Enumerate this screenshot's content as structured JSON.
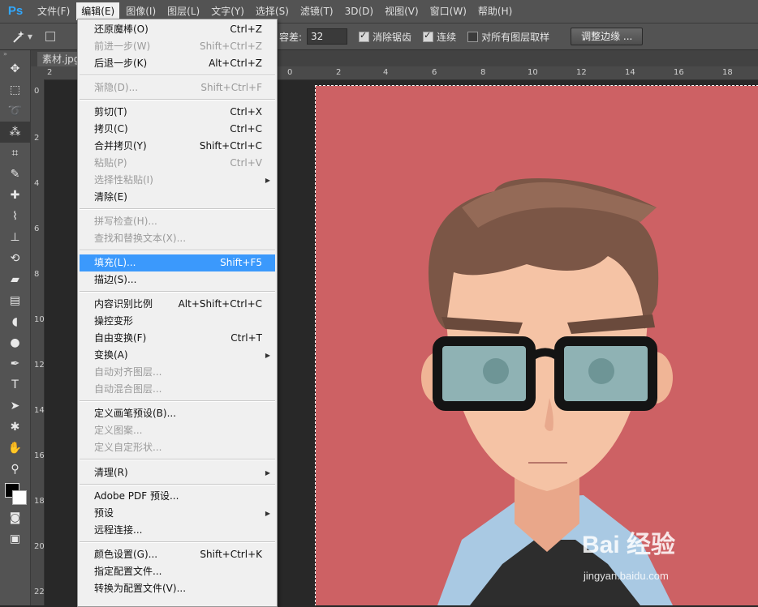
{
  "app": {
    "logo": "Ps"
  },
  "menubar": {
    "items": [
      {
        "label": "文件(F)"
      },
      {
        "label": "编辑(E)"
      },
      {
        "label": "图像(I)"
      },
      {
        "label": "图层(L)"
      },
      {
        "label": "文字(Y)"
      },
      {
        "label": "选择(S)"
      },
      {
        "label": "滤镜(T)"
      },
      {
        "label": "3D(D)"
      },
      {
        "label": "视图(V)"
      },
      {
        "label": "窗口(W)"
      },
      {
        "label": "帮助(H)"
      }
    ]
  },
  "options": {
    "tolerance_label": "容差:",
    "tolerance_value": "32",
    "antialias_label": "消除锯齿",
    "antialias_checked": true,
    "contiguous_label": "连续",
    "contiguous_checked": true,
    "sample_all_label": "对所有图层取样",
    "sample_all_checked": false,
    "refine_edge_label": "调整边缘 ..."
  },
  "document": {
    "tab_label": "素材.jpg",
    "ruler_top": [
      "2",
      "0",
      "2",
      "4",
      "6",
      "8",
      "10",
      "12",
      "14",
      "16",
      "18"
    ],
    "ruler_left": [
      "0",
      "2",
      "4",
      "6",
      "8",
      "10",
      "12",
      "14",
      "16",
      "18",
      "20",
      "22"
    ]
  },
  "edit_menu": {
    "items": [
      {
        "label": "还原魔棒(O)",
        "shortcut": "Ctrl+Z",
        "disabled": false
      },
      {
        "label": "前进一步(W)",
        "shortcut": "Shift+Ctrl+Z",
        "disabled": true
      },
      {
        "label": "后退一步(K)",
        "shortcut": "Alt+Ctrl+Z",
        "disabled": false
      },
      {
        "label": "渐隐(D)...",
        "shortcut": "Shift+Ctrl+F",
        "disabled": true
      },
      {
        "label": "剪切(T)",
        "shortcut": "Ctrl+X",
        "disabled": false
      },
      {
        "label": "拷贝(C)",
        "shortcut": "Ctrl+C",
        "disabled": false
      },
      {
        "label": "合并拷贝(Y)",
        "shortcut": "Shift+Ctrl+C",
        "disabled": false
      },
      {
        "label": "粘贴(P)",
        "shortcut": "Ctrl+V",
        "disabled": true
      },
      {
        "label": "选择性粘贴(I)",
        "shortcut": "",
        "disabled": true,
        "submenu": true
      },
      {
        "label": "清除(E)",
        "shortcut": "",
        "disabled": false
      },
      {
        "label": "拼写检查(H)...",
        "shortcut": "",
        "disabled": true
      },
      {
        "label": "查找和替换文本(X)...",
        "shortcut": "",
        "disabled": true
      },
      {
        "label": "填充(L)...",
        "shortcut": "Shift+F5",
        "disabled": false,
        "highlighted": true
      },
      {
        "label": "描边(S)...",
        "shortcut": "",
        "disabled": false
      },
      {
        "label": "内容识别比例",
        "shortcut": "Alt+Shift+Ctrl+C",
        "disabled": false
      },
      {
        "label": "操控变形",
        "shortcut": "",
        "disabled": false
      },
      {
        "label": "自由变换(F)",
        "shortcut": "Ctrl+T",
        "disabled": false
      },
      {
        "label": "变换(A)",
        "shortcut": "",
        "disabled": false,
        "submenu": true
      },
      {
        "label": "自动对齐图层...",
        "shortcut": "",
        "disabled": true
      },
      {
        "label": "自动混合图层...",
        "shortcut": "",
        "disabled": true
      },
      {
        "label": "定义画笔预设(B)...",
        "shortcut": "",
        "disabled": false
      },
      {
        "label": "定义图案...",
        "shortcut": "",
        "disabled": true
      },
      {
        "label": "定义自定形状...",
        "shortcut": "",
        "disabled": true
      },
      {
        "label": "清理(R)",
        "shortcut": "",
        "disabled": false,
        "submenu": true
      },
      {
        "label": "Adobe PDF 预设...",
        "shortcut": "",
        "disabled": false
      },
      {
        "label": "预设",
        "shortcut": "",
        "disabled": false,
        "submenu": true
      },
      {
        "label": "远程连接...",
        "shortcut": "",
        "disabled": false
      },
      {
        "label": "颜色设置(G)...",
        "shortcut": "Shift+Ctrl+K",
        "disabled": false
      },
      {
        "label": "指定配置文件...",
        "shortcut": "",
        "disabled": false
      },
      {
        "label": "转换为配置文件(V)...",
        "shortcut": "",
        "disabled": false
      }
    ]
  },
  "watermark": {
    "brand": "Bai 经验",
    "url": "jingyan.baidu.com"
  },
  "colors": {
    "canvas_background": "#cd6164",
    "menu_highlight": "#3b99fc"
  }
}
